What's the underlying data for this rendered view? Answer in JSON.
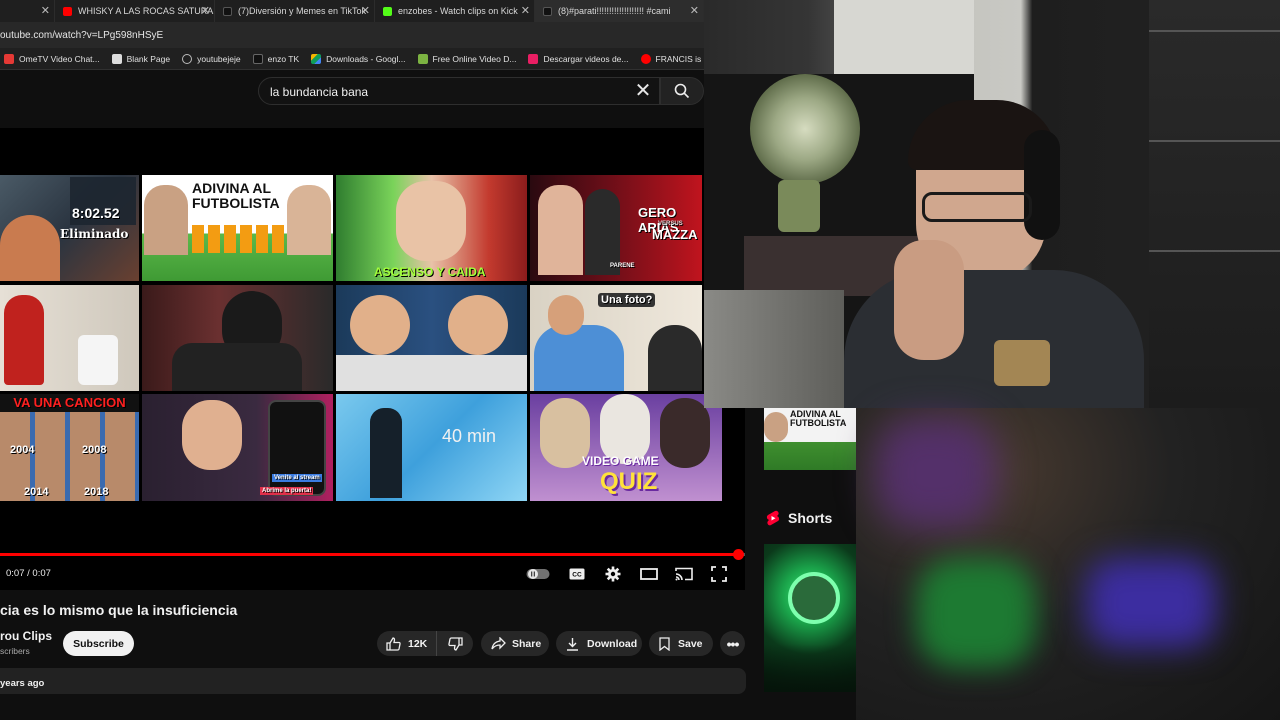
{
  "browser": {
    "tabs": [
      {
        "label": "WHISKY A LAS ROCAS SATURAD",
        "color": "#ff0000"
      },
      {
        "label": "(7)Diversión y Memes en TikTok",
        "color": "#111111"
      },
      {
        "label": "enzobes - Watch clips on Kick",
        "color": "#53fc18"
      },
      {
        "label": "(8)#parati!!!!!!!!!!!!!!!!!!! #cami",
        "color": "#111111"
      }
    ],
    "url": "outube.com/watch?v=LPg598nHSyE",
    "bookmarks": [
      {
        "label": "OmeTV Video Chat...",
        "color": "#e53935"
      },
      {
        "label": "Blank Page",
        "color": "#dddddd"
      },
      {
        "label": "youtubejeje",
        "color": "#9e9e9e"
      },
      {
        "label": "enzo TK",
        "color": "#111111"
      },
      {
        "label": "Downloads - Googl...",
        "color": "#f4b400"
      },
      {
        "label": "Free Online Video D...",
        "color": "#7cb342"
      },
      {
        "label": "Descargar videos de...",
        "color": "#e91e63"
      },
      {
        "label": "FRANCIS is a YOUT...",
        "color": "#ff0000"
      }
    ]
  },
  "search": {
    "query": "la bundancia bana"
  },
  "player": {
    "time": "0:07 / 0:07",
    "progress": 0.99,
    "thumbnails": {
      "t1": {
        "timer": "8:02.52",
        "caption": "Eliminado"
      },
      "t2": {
        "title": "ADIVINA AL FUTBOLISTA"
      },
      "t3": {
        "title": "ASCENSO Y CAIDA"
      },
      "t4": {
        "title": "GERO ARIAS",
        "subtitle": "MAZZA",
        "versus": "VERSUS",
        "badge": "PARENE"
      },
      "t7": {
        "caption": "Una foto?"
      },
      "t9": {
        "title": "VA UNA CANCION",
        "years": [
          "2004",
          "2008",
          "2014",
          "2018"
        ]
      },
      "t10": {
        "caption1": "Venite al stream",
        "caption2": "Abrime la puerta!"
      },
      "t11": {
        "duration": "40 min"
      },
      "t12": {
        "line1": "VIDEO GAME",
        "line2": "QUIZ"
      }
    }
  },
  "video": {
    "title": "cia es lo mismo que la insuficiencia",
    "channel": "rou Clips",
    "subscribers": "scribers",
    "subscribe_label": "Subscribe",
    "likes": "12K",
    "share_label": "Share",
    "download_label": "Download",
    "save_label": "Save",
    "date": "years ago"
  },
  "sidebar": {
    "thumb_title": "ADIVINA AL FUTBOLISTA",
    "shorts_label": "Shorts"
  },
  "colors": {
    "accent": "#ff0000",
    "background": "#0f0f0f",
    "pill": "#272727"
  }
}
